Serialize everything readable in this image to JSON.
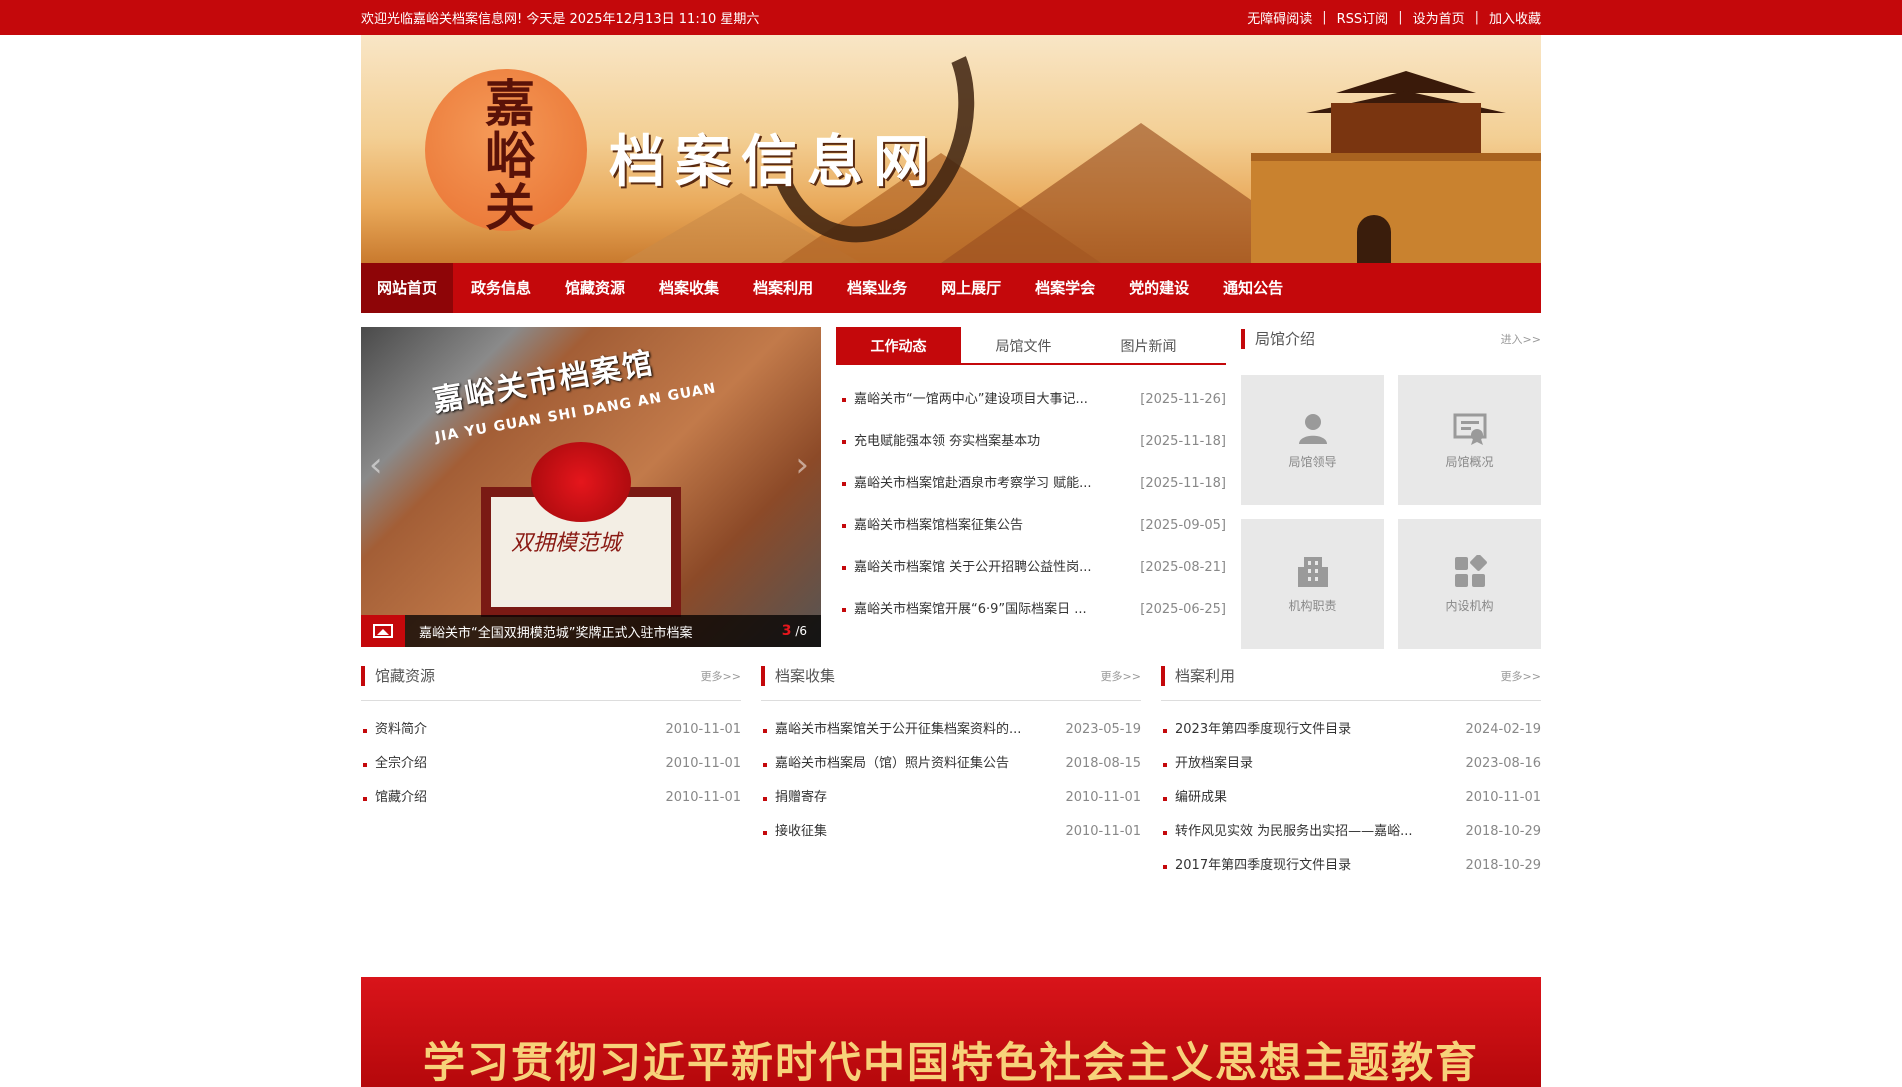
{
  "topbar": {
    "welcome": "欢迎光临嘉峪关档案信息网!  今天是 2025年12月13日 11:10 星期六",
    "links": [
      "无障碍阅读",
      "RSS订阅",
      "设为首页",
      "加入收藏"
    ]
  },
  "banner": {
    "seal_text": "嘉峪关",
    "site_title": "档案信息网"
  },
  "nav": [
    "网站首页",
    "政务信息",
    "馆藏资源",
    "档案收集",
    "档案利用",
    "档案业务",
    "网上展厅",
    "档案学会",
    "党的建设",
    "通知公告"
  ],
  "slider": {
    "building_text": "嘉峪关市档案馆",
    "building_sub": "JIA YU GUAN SHI DANG AN GUAN",
    "plaque_text": "双拥模范城",
    "caption": "嘉峪关市“全国双拥模范城”奖牌正式入驻市档案",
    "current": "3",
    "total": "/6"
  },
  "news": {
    "tabs": [
      "工作动态",
      "局馆文件",
      "图片新闻"
    ],
    "items": [
      {
        "title": "嘉峪关市“一馆两中心”建设项目大事记...",
        "date": "[2025-11-26]"
      },
      {
        "title": "充电赋能强本领 夯实档案基本功",
        "date": "[2025-11-18]"
      },
      {
        "title": "嘉峪关市档案馆赴酒泉市考察学习 赋能...",
        "date": "[2025-11-18]"
      },
      {
        "title": "嘉峪关市档案馆档案征集公告",
        "date": "[2025-09-05]"
      },
      {
        "title": "嘉峪关市档案馆 关于公开招聘公益性岗...",
        "date": "[2025-08-21]"
      },
      {
        "title": "嘉峪关市档案馆开展“6·9”国际档案日 ...",
        "date": "[2025-06-25]"
      }
    ]
  },
  "intro": {
    "title": "局馆介绍",
    "more": "进入>>",
    "cells": [
      {
        "label": "局馆领导",
        "icon": "person-icon"
      },
      {
        "label": "局馆概况",
        "icon": "certificate-icon"
      },
      {
        "label": "机构职责",
        "icon": "building-icon"
      },
      {
        "label": "内设机构",
        "icon": "blocks-icon"
      }
    ]
  },
  "columns": [
    {
      "title": "馆藏资源",
      "more": "更多>>",
      "items": [
        {
          "title": "资料简介",
          "date": "2010-11-01"
        },
        {
          "title": "全宗介绍",
          "date": "2010-11-01"
        },
        {
          "title": "馆藏介绍",
          "date": "2010-11-01"
        }
      ]
    },
    {
      "title": "档案收集",
      "more": "更多>>",
      "items": [
        {
          "title": "嘉峪关市档案馆关于公开征集档案资料的...",
          "date": "2023-05-19"
        },
        {
          "title": "嘉峪关市档案局（馆）照片资料征集公告",
          "date": "2018-08-15"
        },
        {
          "title": "捐赠寄存",
          "date": "2010-11-01"
        },
        {
          "title": "接收征集",
          "date": "2010-11-01"
        }
      ]
    },
    {
      "title": "档案利用",
      "more": "更多>>",
      "items": [
        {
          "title": "2023年第四季度现行文件目录",
          "date": "2024-02-19"
        },
        {
          "title": "开放档案目录",
          "date": "2023-08-16"
        },
        {
          "title": "编研成果",
          "date": "2010-11-01"
        },
        {
          "title": "转作风见实效 为民服务出实招——嘉峪...",
          "date": "2018-10-29"
        },
        {
          "title": "2017年第四季度现行文件目录",
          "date": "2018-10-29"
        }
      ]
    }
  ],
  "bottom_banner": {
    "text": "学习贯彻习近平新时代中国特色社会主义思想主题教育"
  },
  "colors": {
    "brand_red": "#c4080b",
    "nav_active": "#8e0507"
  }
}
